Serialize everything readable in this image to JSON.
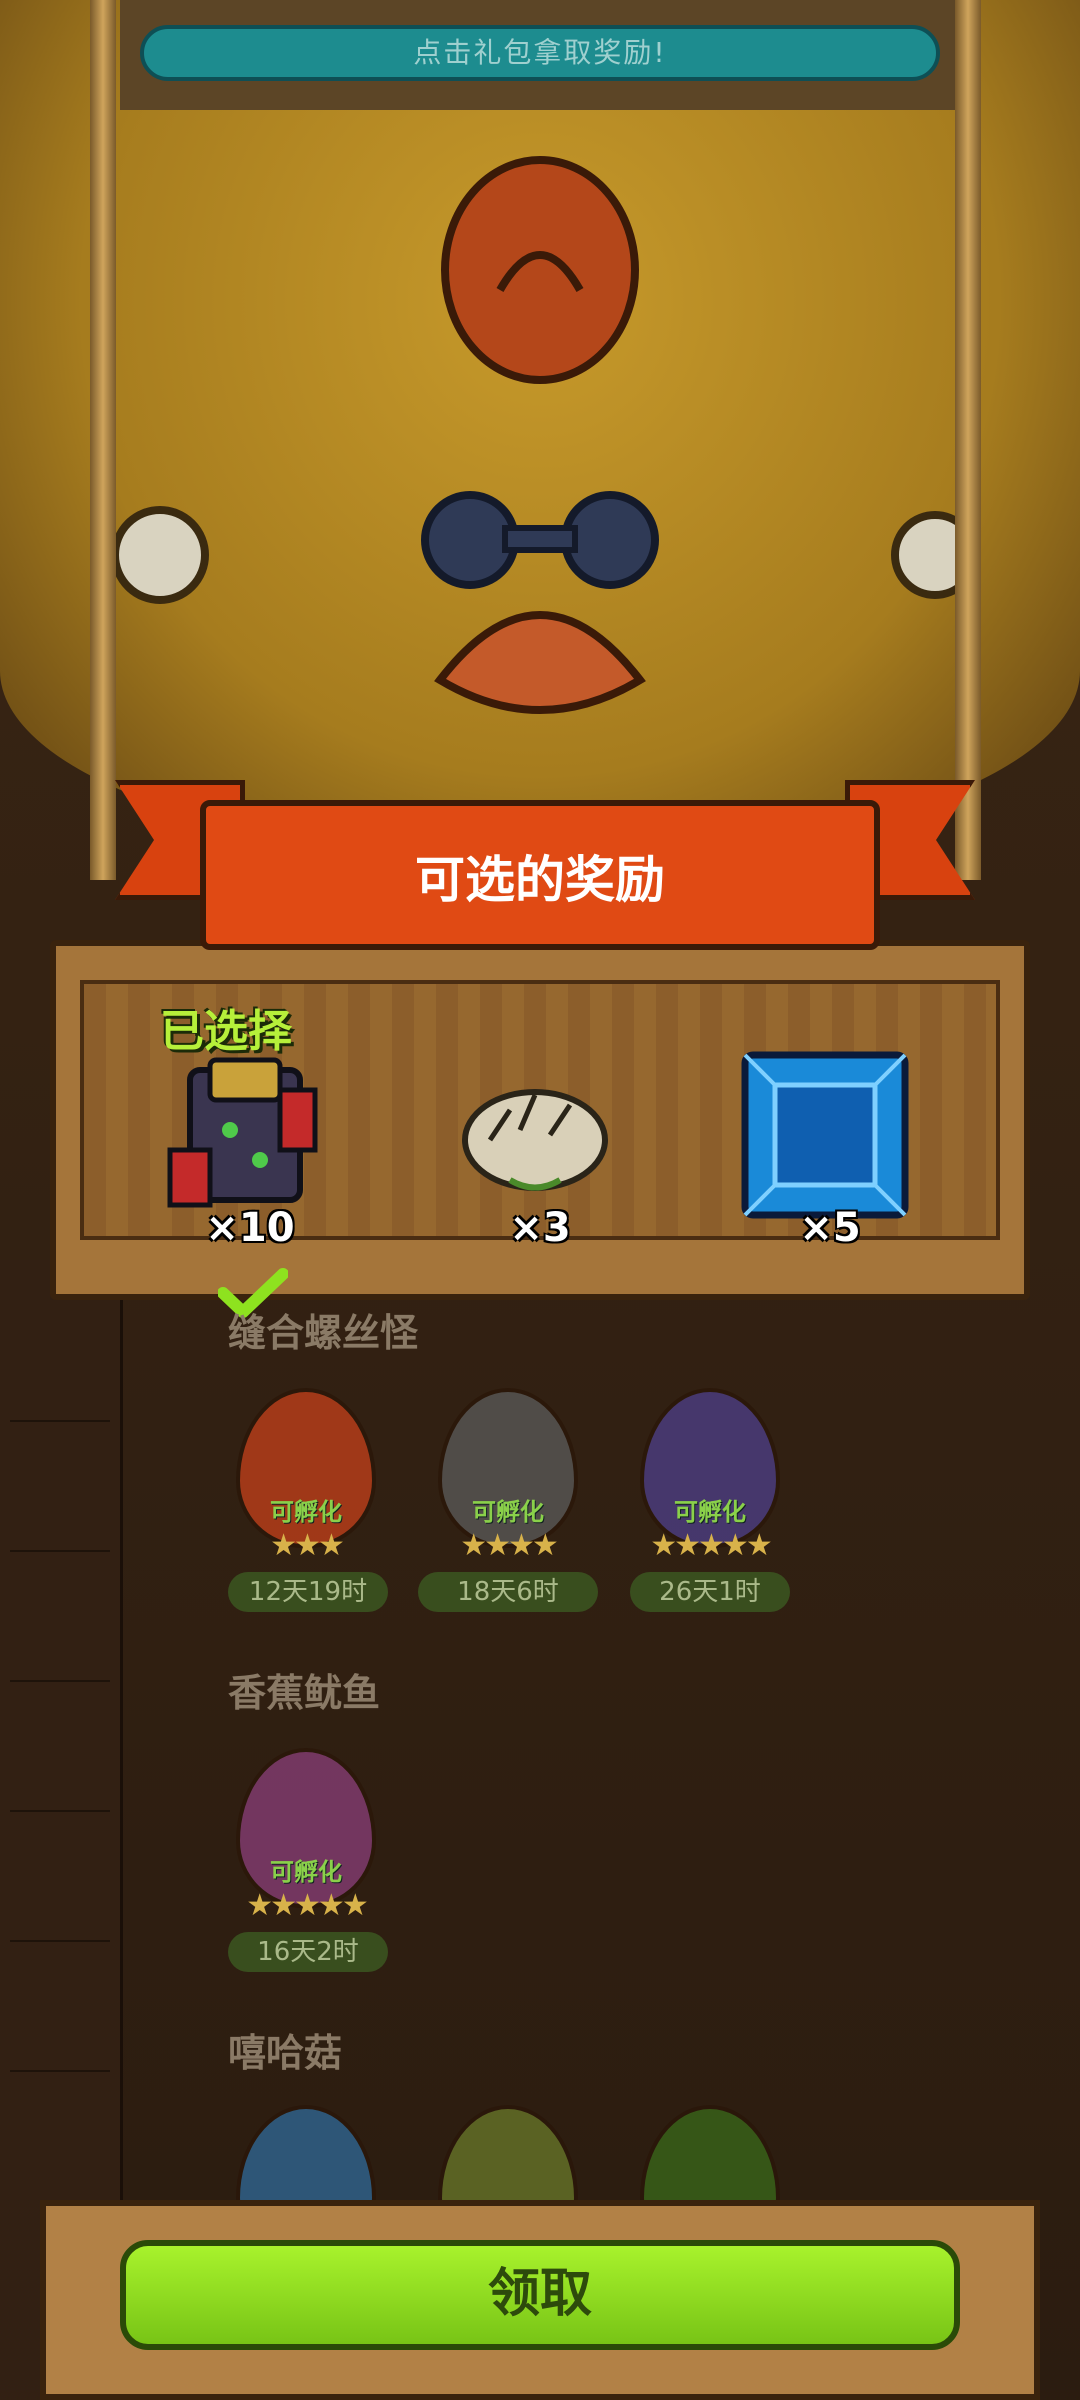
{
  "header": {
    "hint": "点击礼包拿取奖励!"
  },
  "panel": {
    "title": "可选的奖励",
    "selected_label": "已选择",
    "rewards": [
      {
        "icon": "robot-monster-icon",
        "qty": "×10",
        "selected": true
      },
      {
        "icon": "shell-creature-icon",
        "qty": "×3",
        "selected": false
      },
      {
        "icon": "blue-gem-icon",
        "qty": "×5",
        "selected": false
      }
    ]
  },
  "sections": [
    {
      "title": "缝合螺丝怪",
      "eggs": [
        {
          "tag": "可孵化",
          "stars": 3,
          "time": "12天19时",
          "color": "#c6411a"
        },
        {
          "tag": "可孵化",
          "stars": 4,
          "time": "18天6时",
          "color": "#5b5b5b"
        },
        {
          "tag": "可孵化",
          "stars": 5,
          "time": "26天1时",
          "color": "#4d3f8a"
        }
      ]
    },
    {
      "title": "香蕉鱿鱼",
      "eggs": [
        {
          "tag": "可孵化",
          "stars": 5,
          "time": "16天2时",
          "color": "#8a3f7a"
        }
      ]
    },
    {
      "title": "嘻哈菇",
      "eggs": [
        {
          "color": "#2f6a9a"
        },
        {
          "color": "#6a7a2a"
        },
        {
          "color": "#3a6a1a"
        }
      ]
    }
  ],
  "footer": {
    "claim_label": "领取"
  },
  "colors": {
    "accent_green": "#8ee21f",
    "banner_red": "#e04a14",
    "wood": "#a5753a"
  }
}
